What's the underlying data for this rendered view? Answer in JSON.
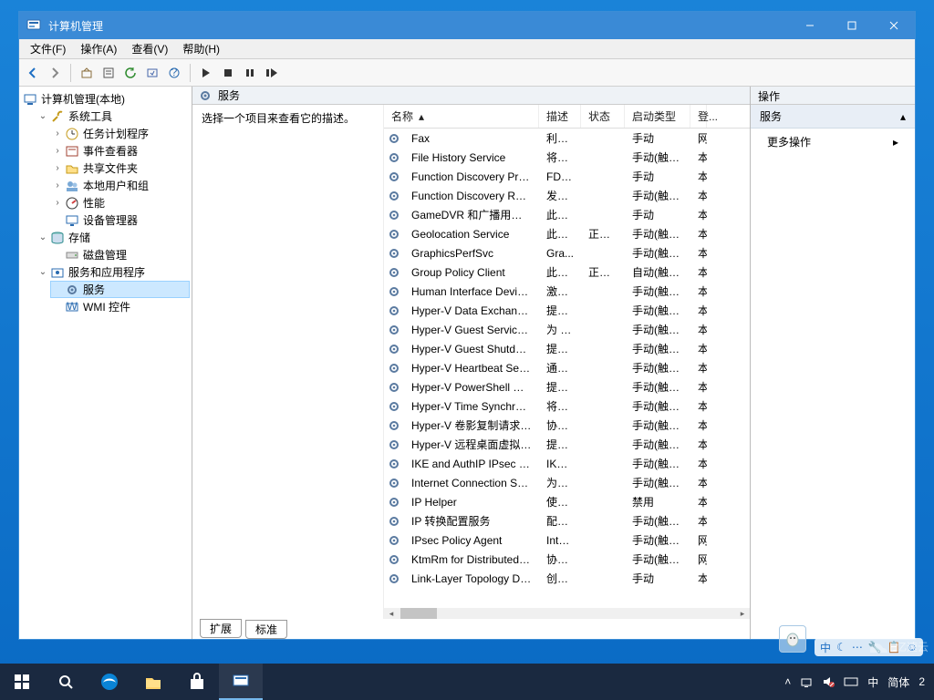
{
  "window": {
    "title": "计算机管理",
    "menus": {
      "file": "文件(F)",
      "action": "操作(A)",
      "view": "查看(V)",
      "help": "帮助(H)"
    }
  },
  "tree": {
    "root": "计算机管理(本地)",
    "sysTools": "系统工具",
    "taskScheduler": "任务计划程序",
    "eventViewer": "事件查看器",
    "sharedFolders": "共享文件夹",
    "localUsers": "本地用户和组",
    "performance": "性能",
    "deviceManager": "设备管理器",
    "storage": "存储",
    "diskMgmt": "磁盘管理",
    "servicesApps": "服务和应用程序",
    "services": "服务",
    "wmi": "WMI 控件"
  },
  "center": {
    "headerTitle": "服务",
    "descPrompt": "选择一个项目来查看它的描述。",
    "columns": {
      "name": "名称",
      "desc": "描述",
      "status": "状态",
      "startup": "启动类型",
      "logon": "登..."
    },
    "tabs": {
      "extended": "扩展",
      "standard": "标准"
    }
  },
  "services": [
    {
      "name": "Fax",
      "desc": "利用...",
      "status": "",
      "startup": "手动",
      "logon": "网"
    },
    {
      "name": "File History Service",
      "desc": "将用...",
      "status": "",
      "startup": "手动(触发...",
      "logon": "本"
    },
    {
      "name": "Function Discovery Provi...",
      "desc": "FDP...",
      "status": "",
      "startup": "手动",
      "logon": "本"
    },
    {
      "name": "Function Discovery Reso...",
      "desc": "发布...",
      "status": "",
      "startup": "手动(触发...",
      "logon": "本"
    },
    {
      "name": "GameDVR 和广播用户服务...",
      "desc": "此用...",
      "status": "",
      "startup": "手动",
      "logon": "本"
    },
    {
      "name": "Geolocation Service",
      "desc": "此服...",
      "status": "正在...",
      "startup": "手动(触发...",
      "logon": "本"
    },
    {
      "name": "GraphicsPerfSvc",
      "desc": "Gra...",
      "status": "",
      "startup": "手动(触发...",
      "logon": "本"
    },
    {
      "name": "Group Policy Client",
      "desc": "此服...",
      "status": "正在...",
      "startup": "自动(触发...",
      "logon": "本"
    },
    {
      "name": "Human Interface Device ...",
      "desc": "激活...",
      "status": "",
      "startup": "手动(触发...",
      "logon": "本"
    },
    {
      "name": "Hyper-V Data Exchange ...",
      "desc": "提供...",
      "status": "",
      "startup": "手动(触发...",
      "logon": "本"
    },
    {
      "name": "Hyper-V Guest Service In...",
      "desc": "为 H...",
      "status": "",
      "startup": "手动(触发...",
      "logon": "本"
    },
    {
      "name": "Hyper-V Guest Shutdown...",
      "desc": "提供...",
      "status": "",
      "startup": "手动(触发...",
      "logon": "本"
    },
    {
      "name": "Hyper-V Heartbeat Service",
      "desc": "通过...",
      "status": "",
      "startup": "手动(触发...",
      "logon": "本"
    },
    {
      "name": "Hyper-V PowerShell Dire...",
      "desc": "提供...",
      "status": "",
      "startup": "手动(触发...",
      "logon": "本"
    },
    {
      "name": "Hyper-V Time Synchroniz...",
      "desc": "将此...",
      "status": "",
      "startup": "手动(触发...",
      "logon": "本"
    },
    {
      "name": "Hyper-V 卷影复制请求程序",
      "desc": "协调...",
      "status": "",
      "startup": "手动(触发...",
      "logon": "本"
    },
    {
      "name": "Hyper-V 远程桌面虚拟化...",
      "desc": "提供...",
      "status": "",
      "startup": "手动(触发...",
      "logon": "本"
    },
    {
      "name": "IKE and AuthIP IPsec Key...",
      "desc": "IKEE...",
      "status": "",
      "startup": "手动(触发...",
      "logon": "本"
    },
    {
      "name": "Internet Connection Shari...",
      "desc": "为家...",
      "status": "",
      "startup": "手动(触发...",
      "logon": "本"
    },
    {
      "name": "IP Helper",
      "desc": "使用...",
      "status": "",
      "startup": "禁用",
      "logon": "本"
    },
    {
      "name": "IP 转换配置服务",
      "desc": "配置...",
      "status": "",
      "startup": "手动(触发...",
      "logon": "本"
    },
    {
      "name": "IPsec Policy Agent",
      "desc": "Inter...",
      "status": "",
      "startup": "手动(触发...",
      "logon": "网"
    },
    {
      "name": "KtmRm for Distributed Tr...",
      "desc": "协调...",
      "status": "",
      "startup": "手动(触发...",
      "logon": "网"
    },
    {
      "name": "Link-Layer Topology Disc...",
      "desc": "创建...",
      "status": "",
      "startup": "手动",
      "logon": "本"
    }
  ],
  "actions": {
    "header": "操作",
    "section": "服务",
    "more": "更多操作"
  },
  "imebar": {
    "zhong": "中"
  },
  "taskbar": {
    "imeLang": "中",
    "imeMode": "简体",
    "clock": "2"
  },
  "watermark": {
    "text": "亿速云"
  }
}
